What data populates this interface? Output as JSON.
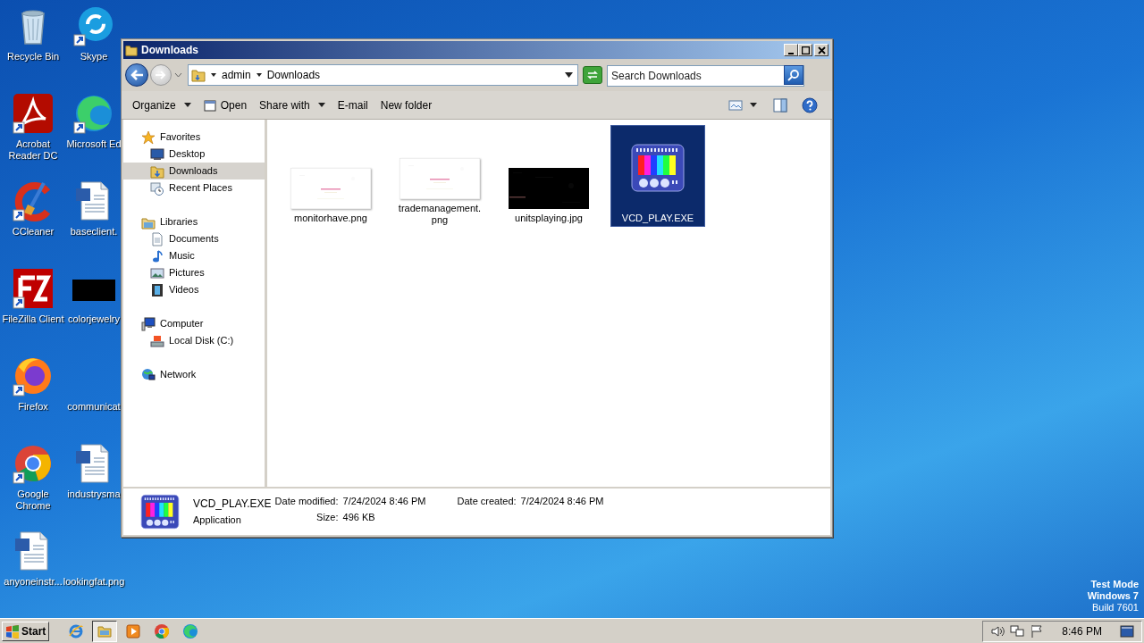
{
  "desktop": {
    "columns": [
      [
        {
          "label": "Recycle Bin",
          "kind": "recycle",
          "shortcut": false
        },
        {
          "label": "Acrobat Reader DC",
          "kind": "acrobat",
          "shortcut": true
        },
        {
          "label": "CCleaner",
          "kind": "ccleaner",
          "shortcut": true
        },
        {
          "label": "FileZilla Client",
          "kind": "filezilla",
          "shortcut": true
        },
        {
          "label": "Firefox",
          "kind": "firefox",
          "shortcut": true
        },
        {
          "label": "Google Chrome",
          "kind": "chrome",
          "shortcut": true
        },
        {
          "label": "anyoneinstr...",
          "kind": "word",
          "shortcut": false
        }
      ],
      [
        {
          "label": "Skype",
          "kind": "skype",
          "shortcut": true
        },
        {
          "label": "Microsoft Ed",
          "kind": "edge",
          "shortcut": true
        },
        {
          "label": "baseclient.",
          "kind": "word",
          "shortcut": false
        },
        {
          "label": "colorjewelry",
          "kind": "dark",
          "shortcut": false
        },
        {
          "label": "communicat",
          "kind": "blank",
          "shortcut": false
        },
        {
          "label": "industrysma",
          "kind": "word",
          "shortcut": false
        },
        {
          "label": "lookingfat.png",
          "kind": "blank",
          "shortcut": false
        }
      ]
    ],
    "notice": [
      "Test Mode",
      "Windows 7",
      "Build 7601"
    ]
  },
  "window": {
    "title": "Downloads",
    "breadcrumb": [
      "admin",
      "Downloads"
    ],
    "search": {
      "placeholder": "Search Downloads"
    },
    "toolbar": [
      {
        "label": "Organize",
        "dropdown": true,
        "kind": "text"
      },
      {
        "label": "Open",
        "dropdown": false,
        "kind": "open"
      },
      {
        "label": "Share with",
        "dropdown": true,
        "kind": "text"
      },
      {
        "label": "E-mail",
        "dropdown": false,
        "kind": "text"
      },
      {
        "label": "New folder",
        "dropdown": false,
        "kind": "text"
      }
    ],
    "nav": [
      {
        "label": "Favorites",
        "kind": "star",
        "selected": false,
        "children": [
          {
            "label": "Desktop",
            "kind": "desktop",
            "selected": false
          },
          {
            "label": "Downloads",
            "kind": "downloads",
            "selected": true
          },
          {
            "label": "Recent Places",
            "kind": "recent",
            "selected": false
          }
        ]
      },
      {
        "label": "Libraries",
        "kind": "libraries",
        "selected": false,
        "children": [
          {
            "label": "Documents",
            "kind": "documents",
            "selected": false
          },
          {
            "label": "Music",
            "kind": "music",
            "selected": false
          },
          {
            "label": "Pictures",
            "kind": "pictures",
            "selected": false
          },
          {
            "label": "Videos",
            "kind": "videos",
            "selected": false
          }
        ]
      },
      {
        "label": "Computer",
        "kind": "computer",
        "selected": false,
        "children": [
          {
            "label": "Local Disk (C:)",
            "kind": "disk",
            "selected": false
          }
        ]
      },
      {
        "label": "Network",
        "kind": "network",
        "selected": false
      }
    ],
    "files": [
      {
        "name": "monitorhave.png",
        "kind": "light_image",
        "selected": false
      },
      {
        "name": "trademanagement.png",
        "kind": "light_image",
        "selected": false
      },
      {
        "name": "unitsplaying.jpg",
        "kind": "dark_image",
        "selected": false
      },
      {
        "name": "VCD_PLAY.EXE",
        "kind": "program",
        "selected": true
      }
    ],
    "details": {
      "name": "VCD_PLAY.EXE",
      "type": "Application",
      "fields": [
        {
          "label": "Date modified:",
          "value": "7/24/2024 8:46 PM"
        },
        {
          "label": "Size:",
          "value": "496 KB"
        },
        {
          "label": "Date created:",
          "value": "7/24/2024 8:46 PM"
        }
      ]
    }
  },
  "taskbar": {
    "start": "Start",
    "apps": [
      {
        "kind": "ie",
        "active": false
      },
      {
        "kind": "explorer",
        "active": true
      },
      {
        "kind": "media",
        "active": false
      },
      {
        "kind": "chrome",
        "active": false
      },
      {
        "kind": "edge",
        "active": false
      }
    ],
    "clock": "8:46 PM"
  }
}
